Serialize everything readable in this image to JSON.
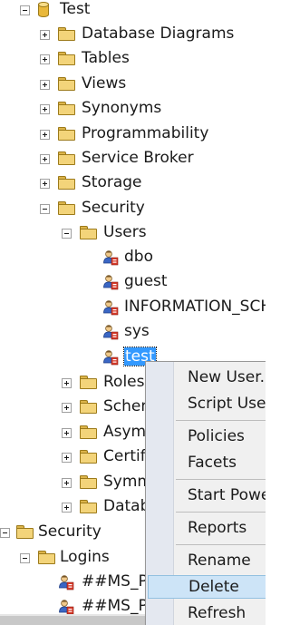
{
  "tree": {
    "database_label": "Test",
    "db_children": [
      "Database Diagrams",
      "Tables",
      "Views",
      "Synonyms",
      "Programmability",
      "Service Broker",
      "Storage",
      "Security"
    ],
    "security_children_label": "Users",
    "users": [
      "dbo",
      "guest",
      "INFORMATION_SCHEMA",
      "sys",
      "test"
    ],
    "selected_user": "test",
    "security_siblings": [
      "Roles",
      "Schemas",
      "Asymmetric Keys",
      "Certificates",
      "Symmetric Keys",
      "Database Audit Specifications"
    ],
    "server_security_label": "Security",
    "logins_label": "Logins",
    "logins": [
      "##MS_PolicyEventProcessingLogin##",
      "##MS_PolicyTsqlExecutionLogin##"
    ]
  },
  "context_menu": {
    "items": [
      "New User...",
      "Script User as",
      "Policies",
      "Facets",
      "Start PowerShell",
      "Reports",
      "Rename",
      "Delete",
      "Refresh"
    ],
    "highlighted": "Delete"
  },
  "icons": {
    "database": "database-icon",
    "folder": "folder-icon",
    "user": "user-icon",
    "login": "login-icon"
  }
}
